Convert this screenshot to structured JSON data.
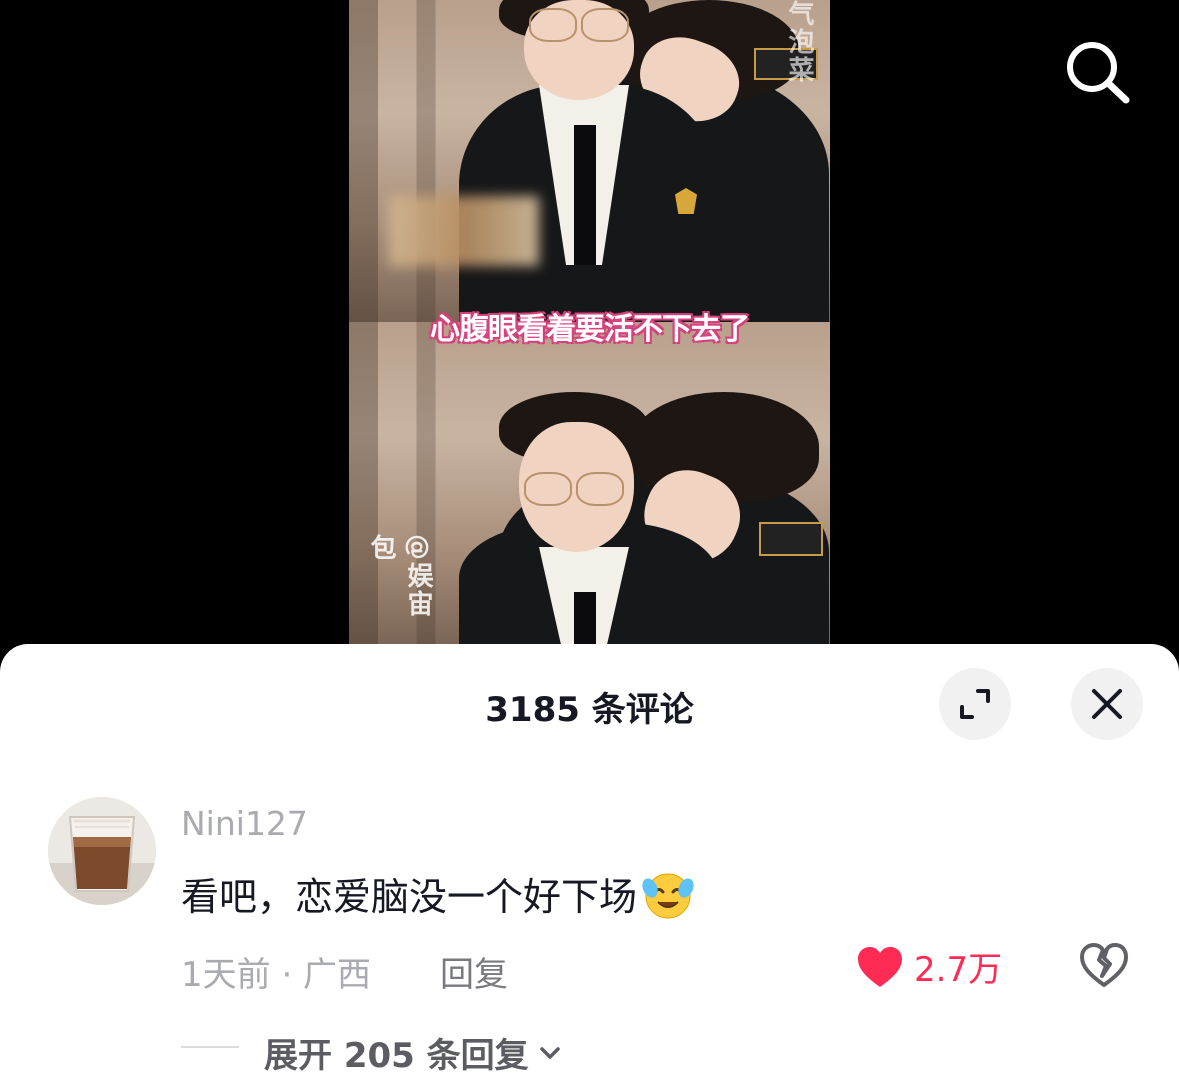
{
  "video": {
    "subtitle": "心腹眼看着要活不下去了",
    "watermark_top": "气泡菜",
    "watermark_bottom": "@娱宙包"
  },
  "comments_sheet": {
    "title": "3185 条评论",
    "comment": {
      "username": "Nini127",
      "text": "看吧，恋爱脑没一个好下场",
      "emoji": "crying-laughing-face",
      "time_location": "1天前 · 广西",
      "reply_label": "回复",
      "like_count": "2.7万",
      "expand_replies_label": "展开 205 条回复"
    }
  },
  "colors": {
    "like": "#fe2c55",
    "title_text": "#161823",
    "secondary_text": "#a9abb0"
  }
}
